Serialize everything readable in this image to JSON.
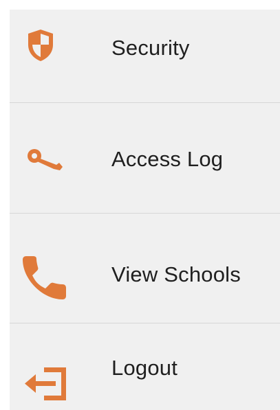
{
  "accent_color": "#e07a3a",
  "menu": {
    "items": [
      {
        "label": "Security",
        "icon": "shield-icon"
      },
      {
        "label": "Access Log",
        "icon": "key-icon"
      },
      {
        "label": "View Schools",
        "icon": "phone-icon"
      },
      {
        "label": "Logout",
        "icon": "logout-icon"
      }
    ]
  }
}
